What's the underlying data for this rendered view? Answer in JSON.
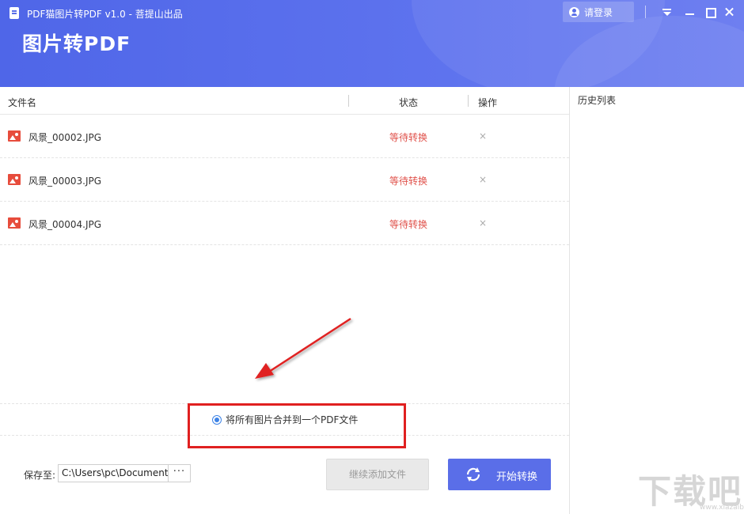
{
  "window": {
    "title": "PDF猫图片转PDF v1.0 - 菩提山出品",
    "heading": "图片转PDF",
    "login_label": "请登录"
  },
  "table": {
    "headers": {
      "filename": "文件名",
      "status": "状态",
      "action": "操作"
    },
    "rows": [
      {
        "name": "风景_00002.JPG",
        "status": "等待转换",
        "remove": "×"
      },
      {
        "name": "风景_00003.JPG",
        "status": "等待转换",
        "remove": "×"
      },
      {
        "name": "风景_00004.JPG",
        "status": "等待转换",
        "remove": "×"
      }
    ]
  },
  "history": {
    "title": "历史列表"
  },
  "options": {
    "merge_label": "将所有图片合并到一个PDF文件",
    "merge_checked": true
  },
  "footer": {
    "save_label": "保存至:",
    "save_path": "C:\\Users\\pc\\Document",
    "browse_label": "···",
    "add_label": "继续添加文件",
    "start_label": "开始转换"
  },
  "watermark": {
    "text": "下载吧",
    "url": "www.xiazaiba.com"
  },
  "colors": {
    "accent": "#5a6ee8",
    "status": "#e0524b",
    "annotation": "#e02020",
    "radio": "#3d83e6"
  }
}
